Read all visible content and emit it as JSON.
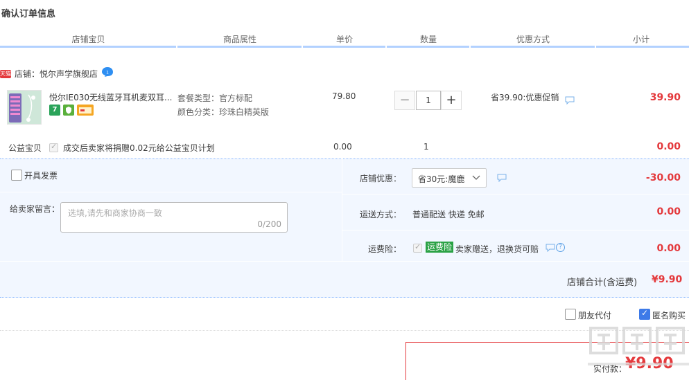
{
  "page": {
    "title": "确认订单信息"
  },
  "columns": [
    "店铺宝贝",
    "商品属性",
    "单价",
    "数量",
    "优惠方式",
    "小计"
  ],
  "shop": {
    "badge": "天猫",
    "name": "店铺：悦尔声学旗舰店"
  },
  "item": {
    "title": "悦尔IE030无线蓝牙耳机麦双耳...",
    "attr_package": "套餐类型：官方标配",
    "attr_color": "颜色分类：珍珠白精英版",
    "service_icon_1": "7",
    "unit_price": "79.80",
    "quantity": "1",
    "qty_minus": "−",
    "qty_plus": "+",
    "promotion": "省39.90:优惠促销",
    "subtotal": "39.90"
  },
  "charity": {
    "label": "公益宝贝",
    "text": "成交后卖家将捐赠0.02元给公益宝贝计划",
    "price": "0.00",
    "quantity": "1",
    "subtotal": "0.00"
  },
  "invoice": {
    "label": "开具发票"
  },
  "message": {
    "label": "给卖家留言：",
    "placeholder": "选填,请先和商家协商一致",
    "counter": "0/200"
  },
  "shop_discount": {
    "label": "店铺优惠：",
    "selected": "省30元:魔鹿",
    "amount": "-30.00"
  },
  "shipping": {
    "label": "运送方式：",
    "value": "普通配送 快递 免邮",
    "amount": "0.00"
  },
  "insurance": {
    "label": "运费险：",
    "badge": "运费险",
    "text": "卖家赠送，退换货可赔",
    "help": "?",
    "amount": "0.00"
  },
  "shop_total": {
    "label": "店铺合计(含运费)",
    "value": "¥9.90"
  },
  "options": {
    "friend_pay": "朋友代付",
    "anonymous": "匿名购买"
  },
  "final": {
    "label": "实付款：",
    "value": "¥9.90"
  },
  "colors": {
    "accent_red": "#e4393c",
    "header_line": "#b2d1ff",
    "panel_bg": "#f2f7ff",
    "check_blue": "#3d7ae8",
    "insurance_green": "#2ba246"
  }
}
